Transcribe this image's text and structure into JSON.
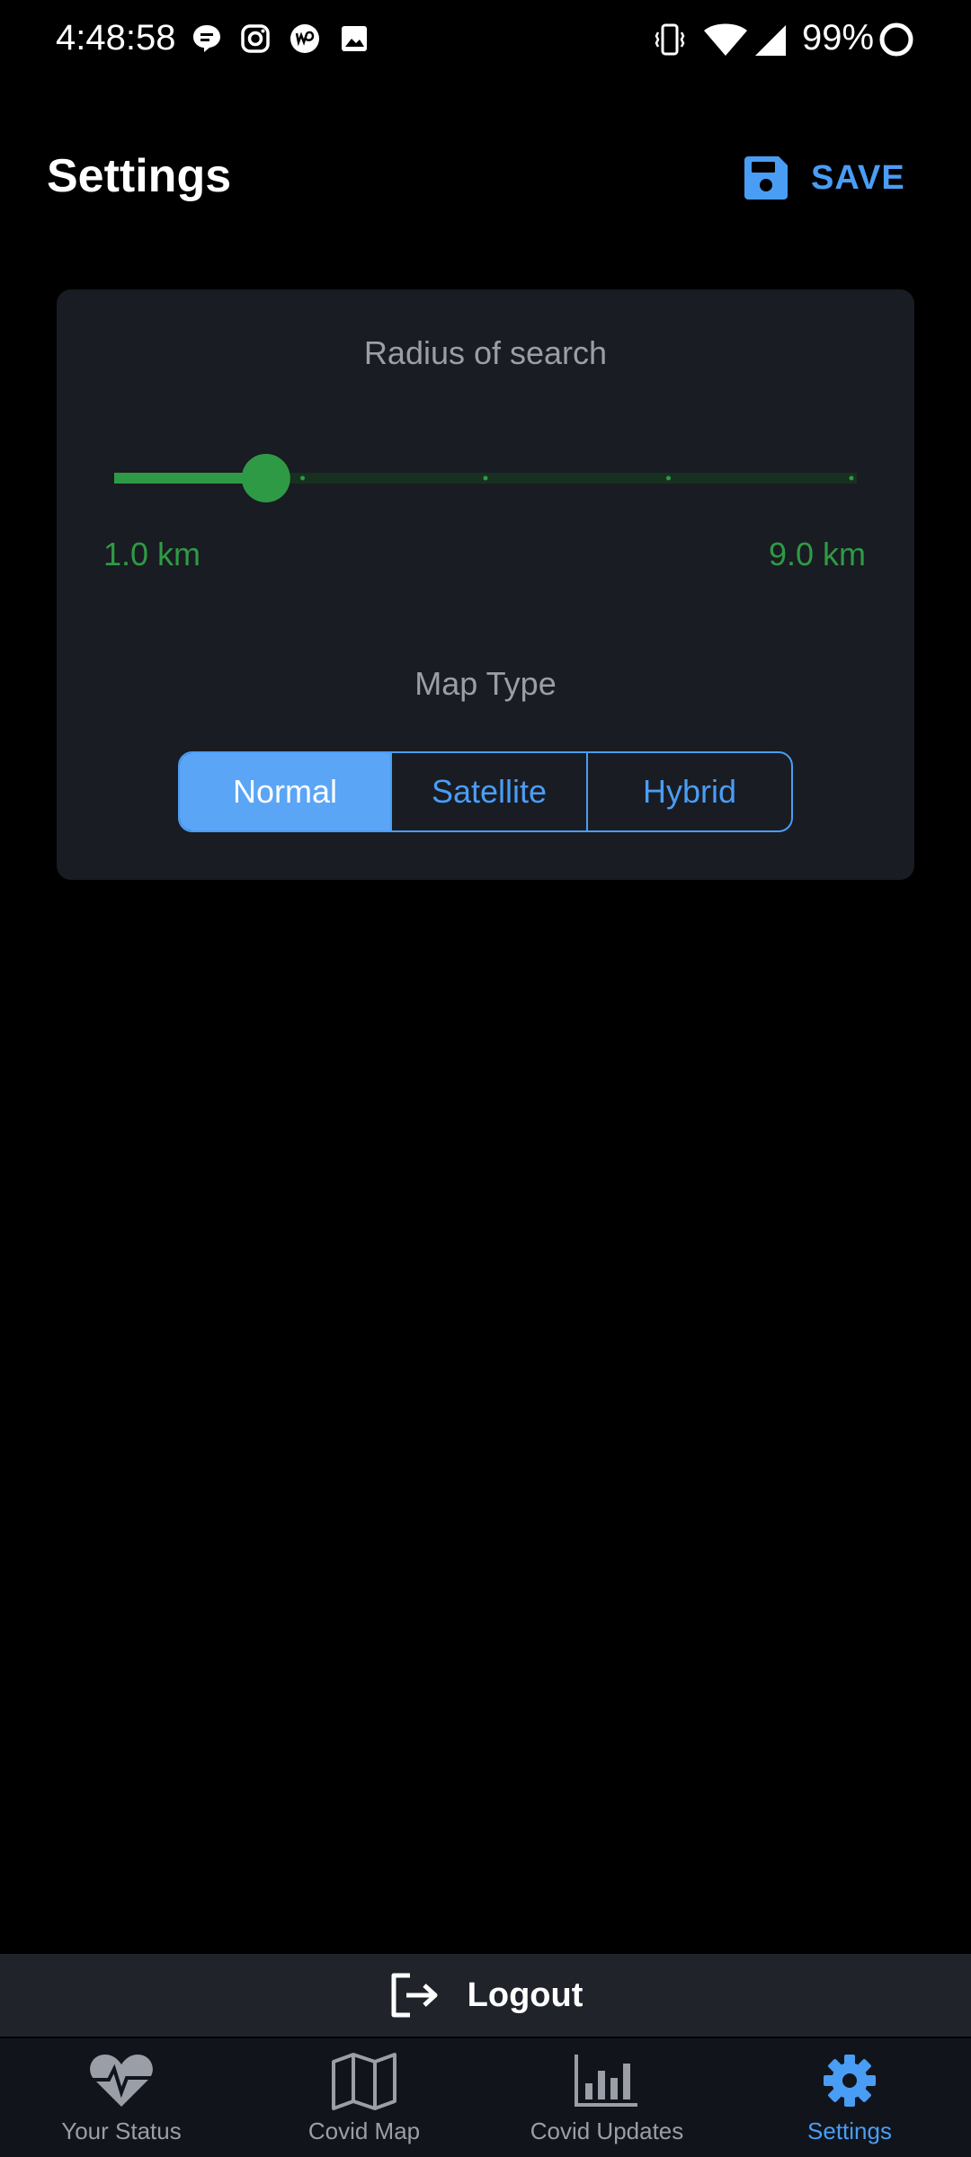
{
  "status_bar": {
    "time": "4:48:58",
    "battery": "99%",
    "left_icons": [
      "chat-bubble-icon",
      "instagram-icon",
      "upwork-icon",
      "image-icon"
    ],
    "right_icons": [
      "vibrate-icon",
      "wifi-icon",
      "signal-icon",
      "battery-ring-icon"
    ]
  },
  "header": {
    "title": "Settings",
    "save_label": "SAVE",
    "save_icon": "floppy-disk-icon"
  },
  "search_radius": {
    "label": "Radius of search",
    "min_label": "1.0 km",
    "max_label": "9.0 km",
    "min": 1.0,
    "max": 9.0,
    "value": 2.6,
    "tick_values": [
      3.0,
      5.0,
      7.0,
      9.0
    ],
    "unit": "km"
  },
  "map_type": {
    "label": "Map Type",
    "options": [
      "Normal",
      "Satellite",
      "Hybrid"
    ],
    "selected": "Normal"
  },
  "logout": {
    "label": "Logout",
    "icon": "logout-icon"
  },
  "bottom_nav": {
    "items": [
      {
        "label": "Your Status",
        "icon": "heartbeat-icon"
      },
      {
        "label": "Covid Map",
        "icon": "map-icon"
      },
      {
        "label": "Covid Updates",
        "icon": "bar-chart-icon"
      },
      {
        "label": "Settings",
        "icon": "gear-icon"
      }
    ],
    "active": "Settings"
  },
  "colors": {
    "accent_blue": "#4a9df5",
    "slider_green": "#2f9a45",
    "card_bg": "#191c22",
    "background": "#000000"
  }
}
